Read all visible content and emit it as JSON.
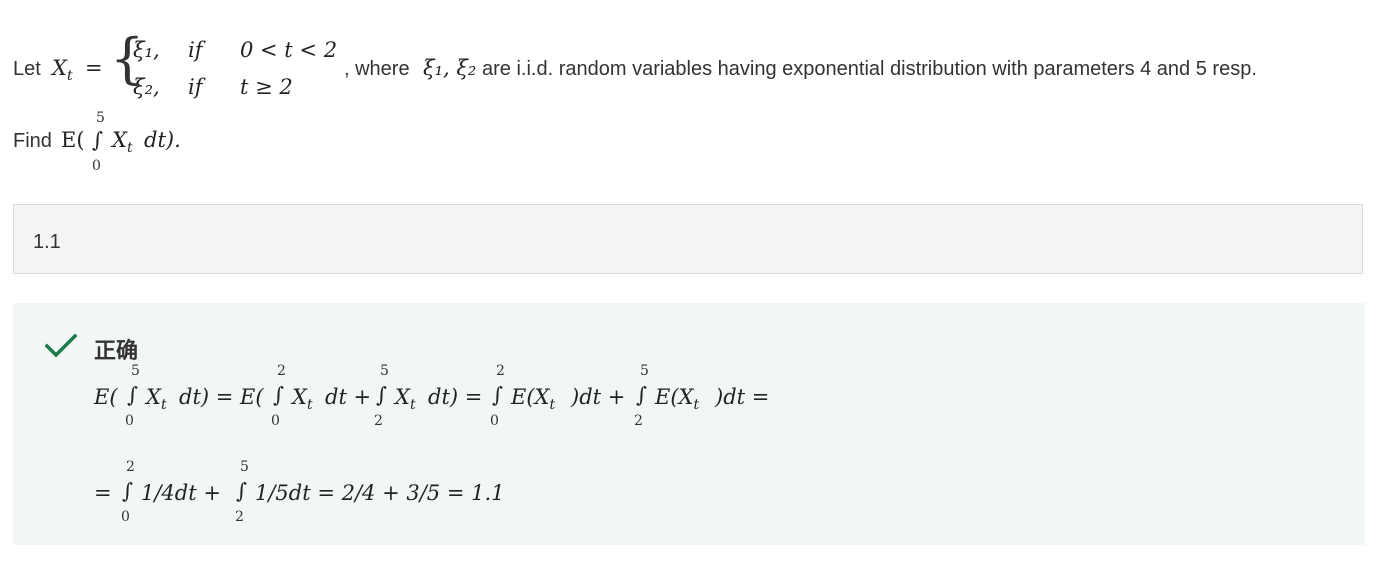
{
  "question": {
    "let_label": "Let",
    "lhs": "X",
    "lhs_sub": "t",
    "equals": "=",
    "case1_value": "ξ₁,",
    "case1_if": "if",
    "case1_cond": "0 < t < 2",
    "case2_value": "ξ₂,",
    "case2_if": "if",
    "case2_cond": "t ≥ 2",
    "where_prefix": ", where",
    "where_vars": "ξ₁, ξ₂",
    "where_text": "are i.i.d. random variables having exponential distribution  with parameters 4 and 5 resp.",
    "find_label": "Find",
    "find_expr_pre": "E(",
    "find_integral": "∫",
    "find_upper": "5",
    "find_lower": "0",
    "find_expr_post": "X",
    "find_expr_sub": "t",
    "find_expr_end": "dt)."
  },
  "answer": {
    "value": "1.1"
  },
  "feedback": {
    "status_label": "正确",
    "status_color": "#1f7a4d",
    "icon": "checkmark-icon",
    "line1": {
      "t1": "E(",
      "i1_upper": "5",
      "i1_lower": "0",
      "t2": "X",
      "t2_sub": "t",
      "t3": "dt) = E(",
      "i2_upper": "2",
      "i2_lower": "0",
      "t4": "X",
      "t4_sub": "t",
      "t5": "dt +",
      "i3_upper": "5",
      "i3_lower": "2",
      "t6": "X",
      "t6_sub": "t",
      "t7": "dt) =",
      "i4_upper": "2",
      "i4_lower": "0",
      "t8": "E(X",
      "t8_sub": "t",
      "t9": ")dt +",
      "i5_upper": "5",
      "i5_lower": "2",
      "t10": "E(X",
      "t10_sub": "t",
      "t11": ")dt ="
    },
    "line2": {
      "t1": "=",
      "i1_upper": "2",
      "i1_lower": "0",
      "t2": "1/4dt +",
      "i2_upper": "5",
      "i2_lower": "2",
      "t3": "1/5dt = 2/4 + 3/5 = 1.1"
    }
  }
}
